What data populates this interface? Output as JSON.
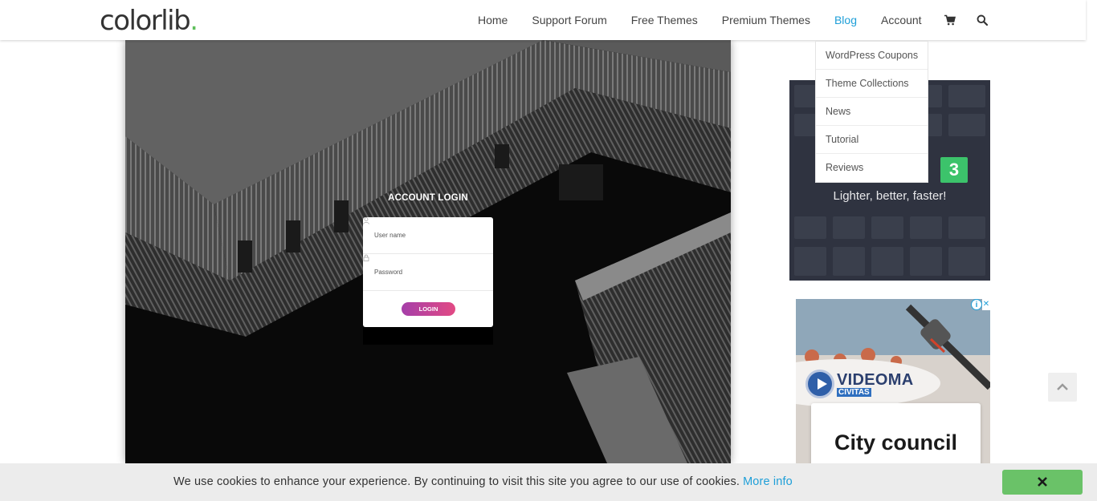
{
  "header": {
    "logo_text": "colorlib",
    "logo_dot": ".",
    "logo_dot_color": "#5fbf5b",
    "nav": [
      {
        "label": "Home"
      },
      {
        "label": "Support Forum"
      },
      {
        "label": "Free Themes"
      },
      {
        "label": "Premium Themes"
      },
      {
        "label": "Blog",
        "active": true
      },
      {
        "label": "Account"
      }
    ],
    "cart_icon": "shopping-cart-icon",
    "search_icon": "search-icon",
    "accent_color": "#1e9fd8"
  },
  "dropdown": {
    "items": [
      "WordPress Coupons",
      "Theme Collections",
      "News",
      "Tutorial",
      "Reviews"
    ]
  },
  "hero": {
    "login_title": "ACCOUNT LOGIN",
    "username_label": "User name",
    "password_label": "Password",
    "login_button": "LOGIN",
    "button_colors": [
      "#a53fa9",
      "#e24a84"
    ]
  },
  "ad_sidebar_1": {
    "badge": "3",
    "tagline": "Lighter, better, faster!",
    "badge_color": "#3cc36b"
  },
  "ad_sidebar_2": {
    "brand": "VIDEOMA",
    "brand_sub": "CIVITAS",
    "headline": "City council",
    "info_icon": "info-icon",
    "close_icon": "close-icon"
  },
  "back_to_top_icon": "chevron-up-icon",
  "cookie_bar": {
    "text": "We use cookies to enhance your experience. By continuing to visit this site you agree to our use of cookies.",
    "more_info": "More info",
    "close_icon": "close-icon",
    "close_color": "#6ac268"
  }
}
